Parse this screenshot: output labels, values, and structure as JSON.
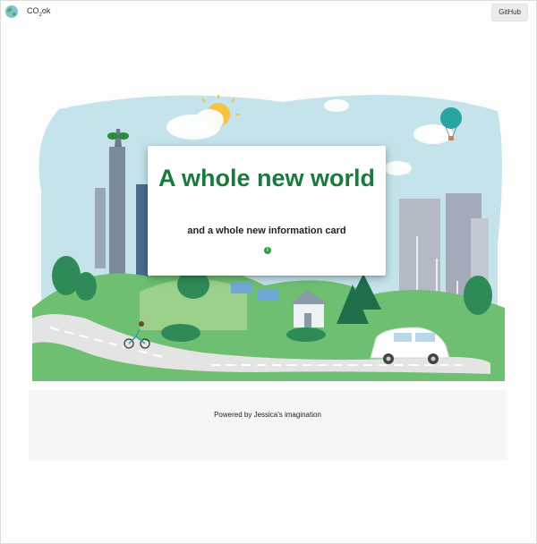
{
  "topbar": {
    "brand": "CO",
    "brand_sub": "2",
    "brand_suffix": "ok",
    "github_label": "GitHub",
    "logo_icon": "earth-logo-icon"
  },
  "card": {
    "title": "A whole new world",
    "subtitle": "and a whole new information card",
    "info_icon": "info-icon",
    "info_glyph": "i"
  },
  "footer": {
    "text": "Powered by Jessica's imagination"
  },
  "colors": {
    "brand_green": "#1a7a3e",
    "sky": "#c5e3ea",
    "road": "#e4e4e4",
    "info_green": "#2f9e44"
  }
}
